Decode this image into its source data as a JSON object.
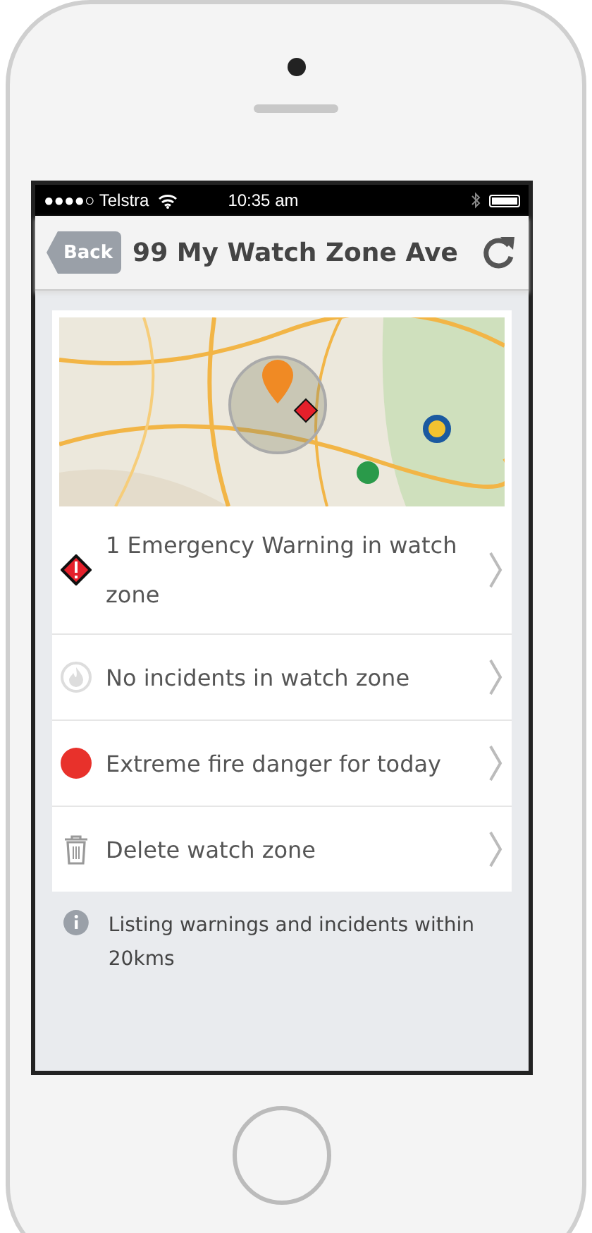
{
  "status_bar": {
    "carrier": "●●●●○ Telstra",
    "time": "10:35 am"
  },
  "nav_bar": {
    "back": "Back",
    "title": "99 My Watch Zone Ave"
  },
  "items": [
    {
      "kind": "warning",
      "text": "1 Emergency Warning in watch zone"
    },
    {
      "kind": "fire",
      "text": "No incidents in watch zone"
    },
    {
      "kind": "danger",
      "text": "Extreme fire danger for today"
    },
    {
      "kind": "trash",
      "text": "Delete watch zone"
    }
  ],
  "footnote": "Listing warnings and incidents within 20kms"
}
